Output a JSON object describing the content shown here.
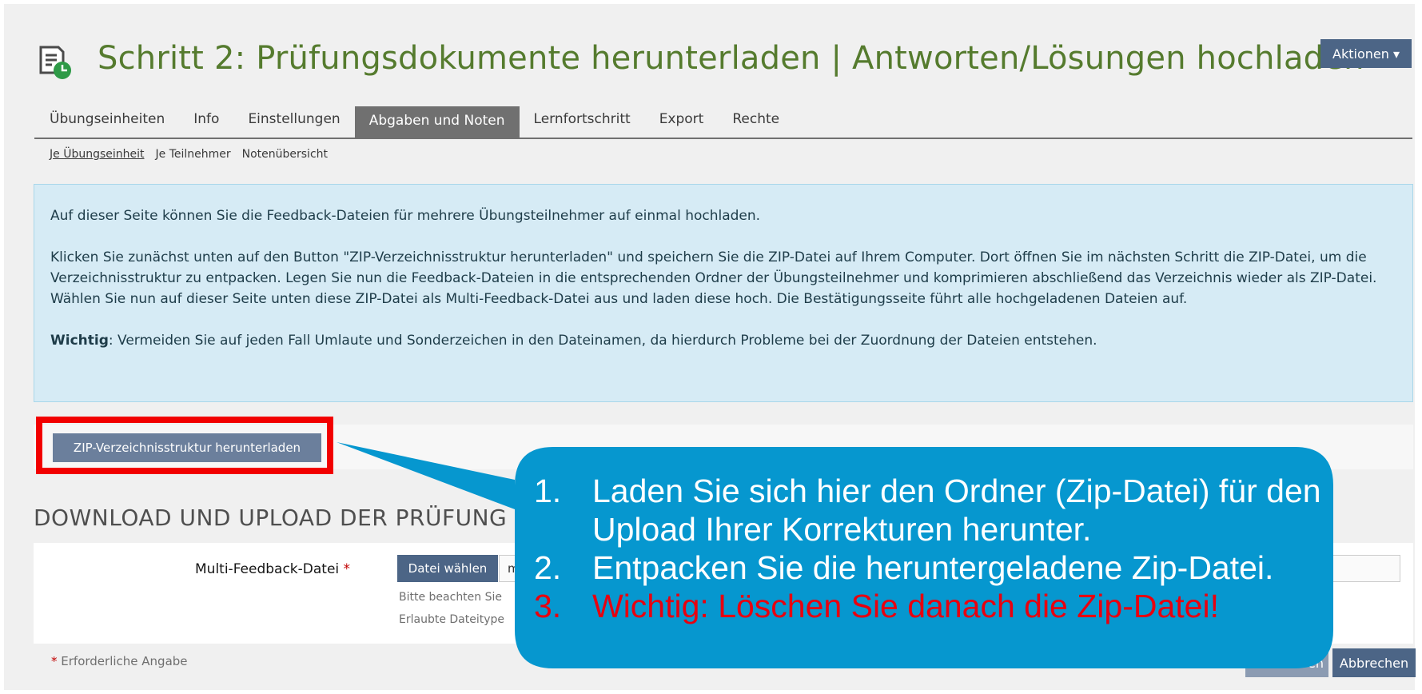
{
  "header": {
    "title": "Schritt 2: Prüfungsdokumente herunterladen | Antworten/Lösungen hochladen",
    "actions_label": "Aktionen ▾",
    "icon": "document-clock-icon"
  },
  "tabs": [
    {
      "label": "Übungseinheiten"
    },
    {
      "label": "Info"
    },
    {
      "label": "Einstellungen"
    },
    {
      "label": "Abgaben und Noten",
      "active": true
    },
    {
      "label": "Lernfortschritt"
    },
    {
      "label": "Export"
    },
    {
      "label": "Rechte"
    }
  ],
  "subtabs": [
    {
      "label": "Je Übungseinheit",
      "active": true
    },
    {
      "label": "Je Teilnehmer"
    },
    {
      "label": "Notenübersicht"
    }
  ],
  "info": {
    "p1": "Auf dieser Seite können Sie die Feedback-Dateien für mehrere Übungsteilnehmer auf einmal hochladen.",
    "p2": "Klicken Sie zunächst unten auf den Button \"ZIP-Verzeichnisstruktur herunterladen\" und speichern Sie die ZIP-Datei auf Ihrem Computer. Dort öffnen Sie im nächsten Schritt die ZIP-Datei, um die Verzeichnisstruktur zu entpacken. Legen Sie nun die Feedback-Dateien in die entsprechenden Ordner der Übungsteilnehmer und komprimieren abschließend das Verzeichnis wieder als ZIP-Datei. Wählen Sie nun auf dieser Seite unten diese ZIP-Datei als Multi-Feedback-Datei aus und laden diese hoch. Die Bestätigungsseite führt alle hochgeladenen Dateien auf.",
    "p3_bold": "Wichtig",
    "p3_rest": ": Vermeiden Sie auf jeden Fall Umlaute und Sonderzeichen in den Dateinamen, da hierdurch Probleme bei der Zuordnung der Dateien entstehen."
  },
  "toolbar": {
    "zip_button": "ZIP-Verzeichnisstruktur herunterladen"
  },
  "form": {
    "section_title": "DOWNLOAD UND UPLOAD DER PRÜFUNG (VE",
    "field_label": "Multi-Feedback-Datei",
    "required_star": "*",
    "choose_file": "Datei wählen",
    "file_value": "m",
    "hint1": "Bitte beachten Sie",
    "hint2": "Erlaubte Dateitype",
    "required_note": "Erforderliche Angabe",
    "save_label": "en",
    "cancel_label": "Abbrechen"
  },
  "callout": {
    "items": [
      {
        "num": "1.",
        "text": "Laden Sie sich hier den Ordner (Zip-Datei) für den Upload Ihrer Korrekturen herunter."
      },
      {
        "num": "2.",
        "text": "Entpacken Sie die heruntergeladene Zip-Datei."
      },
      {
        "num": "3.",
        "text": "Wichtig: Löschen Sie danach die Zip-Datei!"
      }
    ]
  },
  "colors": {
    "title_green": "#557b2e",
    "button_blue": "#4c6586",
    "callout_blue": "#0697cf",
    "highlight_red": "#f20000",
    "info_bg": "#d6ebf5"
  }
}
